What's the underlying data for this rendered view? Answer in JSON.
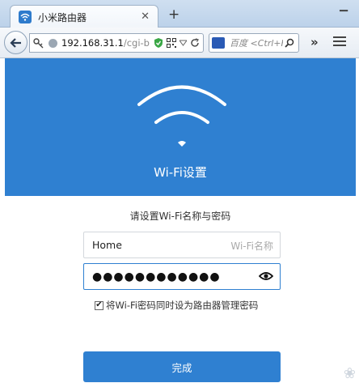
{
  "browser": {
    "tab_title": "小米路由器",
    "tab_close": "✕",
    "new_tab": "+",
    "window_control": "▁",
    "url_host": "192.168.31.1",
    "url_path": "/cgi-b",
    "search_placeholder": "百度 <Ctrl+K>",
    "overflow": "»"
  },
  "page": {
    "header_title": "Wi-Fi设置",
    "subtitle": "请设置Wi-Fi名称与密码",
    "ssid_value": "Home",
    "ssid_placeholder": "Wi-Fi名称",
    "password_value": "●●●●●●●●●●●●",
    "agree_checked": "✔",
    "agree_label": "将Wi-Fi密码同时设为路由器管理密码",
    "submit_label": "完成"
  },
  "colors": {
    "accent": "#2f80d1"
  }
}
